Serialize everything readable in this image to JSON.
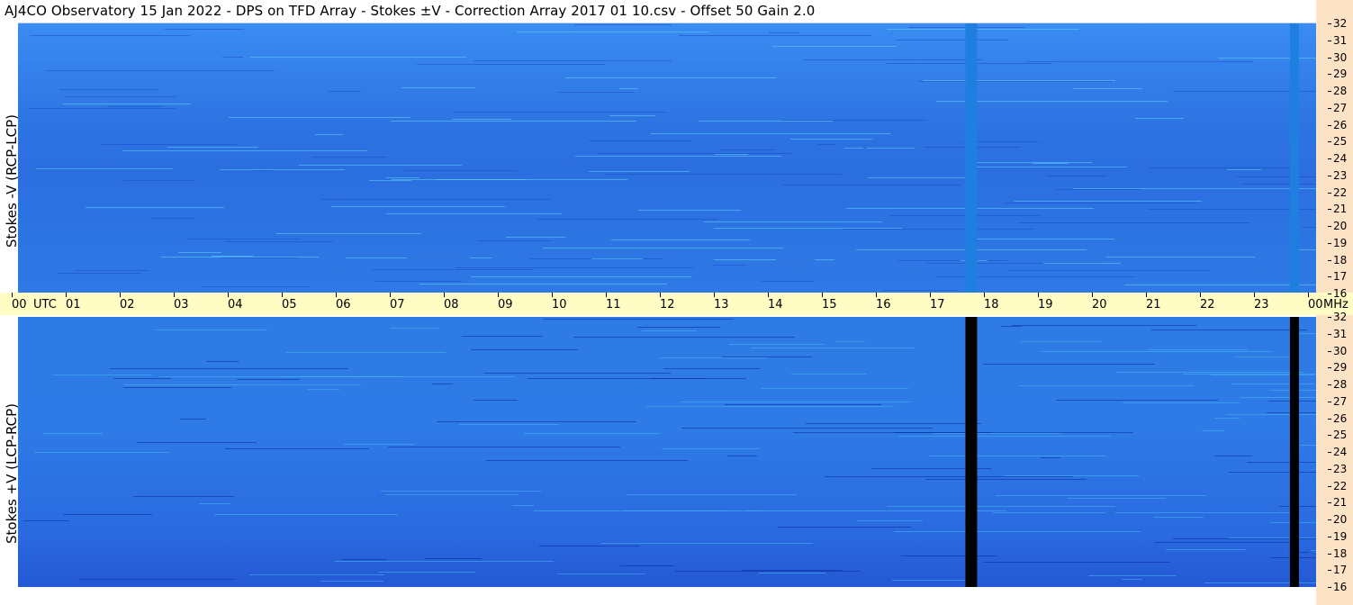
{
  "title": "AJ4CO Observatory  15 Jan 2022  -  DPS on TFD Array  -  Stokes ±V  -  Correction Array 2017 01 10.csv  -  Offset 50  Gain 2.0",
  "chart_data": [
    {
      "type": "heatmap",
      "panel": "top",
      "ylabel": "Stokes -V (RCP-LCP)",
      "xlabel": "UTC",
      "x_ticks": [
        "00",
        "01",
        "02",
        "03",
        "04",
        "05",
        "06",
        "07",
        "08",
        "09",
        "10",
        "11",
        "12",
        "13",
        "14",
        "15",
        "16",
        "17",
        "18",
        "19",
        "20",
        "21",
        "22",
        "23",
        "00"
      ],
      "xlim": [
        0,
        24
      ],
      "y_unit": "MHz",
      "y_ticks": [
        32,
        31,
        30,
        29,
        28,
        27,
        26,
        25,
        24,
        23,
        22,
        21,
        20,
        19,
        18,
        17,
        16
      ],
      "ylim": [
        16,
        32
      ],
      "dominant_color": "#2b73e3",
      "gaps_utc": [
        17.3,
        23.3
      ],
      "gap_color": "#1f7fe0"
    },
    {
      "type": "heatmap",
      "panel": "bottom",
      "ylabel": "Stokes +V (LCP-RCP)",
      "xlabel": "UTC",
      "x_ticks": [
        "00",
        "01",
        "02",
        "03",
        "04",
        "05",
        "06",
        "07",
        "08",
        "09",
        "10",
        "11",
        "12",
        "13",
        "14",
        "15",
        "16",
        "17",
        "18",
        "19",
        "20",
        "21",
        "22",
        "23",
        "00"
      ],
      "xlim": [
        0,
        24
      ],
      "y_unit": "MHz",
      "y_ticks": [
        32,
        31,
        30,
        29,
        28,
        27,
        26,
        25,
        24,
        23,
        22,
        21,
        20,
        19,
        18,
        17,
        16
      ],
      "ylim": [
        16,
        32
      ],
      "dominant_color": "#2b73e3",
      "gaps_utc": [
        17.3,
        23.3
      ],
      "gap_color": "#000000"
    }
  ],
  "time_axis": {
    "utc_label": "UTC",
    "mhz_label": "MHz"
  }
}
